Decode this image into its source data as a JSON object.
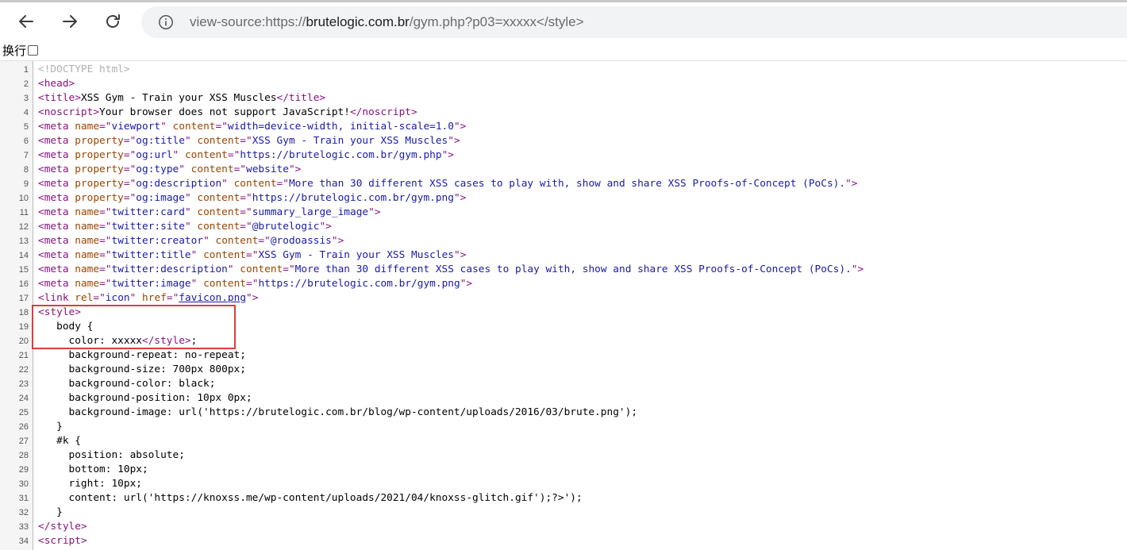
{
  "toolbar": {
    "url_scheme": "view-source:https://",
    "url_host": "brutelogic.com.br",
    "url_path": "/gym.php?p03=xxxxx</style>"
  },
  "wrap_toggle": {
    "label": "换行",
    "checked": false
  },
  "source_lines": [
    {
      "n": "1",
      "segs": [
        {
          "c": "cm",
          "t": "<!DOCTYPE html>"
        }
      ]
    },
    {
      "n": "2",
      "segs": [
        {
          "c": "tag",
          "t": "<head>"
        }
      ]
    },
    {
      "n": "3",
      "segs": [
        {
          "c": "tag",
          "t": "<title>"
        },
        {
          "c": "txt",
          "t": "XSS Gym - Train your XSS Muscles"
        },
        {
          "c": "tag",
          "t": "</title>"
        }
      ]
    },
    {
      "n": "4",
      "segs": [
        {
          "c": "tag",
          "t": "<noscript>"
        },
        {
          "c": "txt",
          "t": "Your browser does not support JavaScript!"
        },
        {
          "c": "tag",
          "t": "</noscript>"
        }
      ]
    },
    {
      "n": "5",
      "segs": [
        {
          "c": "tag",
          "t": "<meta "
        },
        {
          "c": "attr",
          "t": "name"
        },
        {
          "c": "tag",
          "t": "=\""
        },
        {
          "c": "val",
          "t": "viewport"
        },
        {
          "c": "tag",
          "t": "\" "
        },
        {
          "c": "attr",
          "t": "content"
        },
        {
          "c": "tag",
          "t": "=\""
        },
        {
          "c": "val",
          "t": "width=device-width, initial-scale=1.0"
        },
        {
          "c": "tag",
          "t": "\">"
        }
      ]
    },
    {
      "n": "6",
      "segs": [
        {
          "c": "tag",
          "t": "<meta "
        },
        {
          "c": "attr",
          "t": "property"
        },
        {
          "c": "tag",
          "t": "=\""
        },
        {
          "c": "val",
          "t": "og:title"
        },
        {
          "c": "tag",
          "t": "\" "
        },
        {
          "c": "attr",
          "t": "content"
        },
        {
          "c": "tag",
          "t": "=\""
        },
        {
          "c": "val",
          "t": "XSS Gym - Train your XSS Muscles"
        },
        {
          "c": "tag",
          "t": "\">"
        }
      ]
    },
    {
      "n": "7",
      "segs": [
        {
          "c": "tag",
          "t": "<meta "
        },
        {
          "c": "attr",
          "t": "property"
        },
        {
          "c": "tag",
          "t": "=\""
        },
        {
          "c": "val",
          "t": "og:url"
        },
        {
          "c": "tag",
          "t": "\" "
        },
        {
          "c": "attr",
          "t": "content"
        },
        {
          "c": "tag",
          "t": "=\""
        },
        {
          "c": "val",
          "t": "https://brutelogic.com.br/gym.php"
        },
        {
          "c": "tag",
          "t": "\">"
        }
      ]
    },
    {
      "n": "8",
      "segs": [
        {
          "c": "tag",
          "t": "<meta "
        },
        {
          "c": "attr",
          "t": "property"
        },
        {
          "c": "tag",
          "t": "=\""
        },
        {
          "c": "val",
          "t": "og:type"
        },
        {
          "c": "tag",
          "t": "\" "
        },
        {
          "c": "attr",
          "t": "content"
        },
        {
          "c": "tag",
          "t": "=\""
        },
        {
          "c": "val",
          "t": "website"
        },
        {
          "c": "tag",
          "t": "\">"
        }
      ]
    },
    {
      "n": "9",
      "segs": [
        {
          "c": "tag",
          "t": "<meta "
        },
        {
          "c": "attr",
          "t": "property"
        },
        {
          "c": "tag",
          "t": "=\""
        },
        {
          "c": "val",
          "t": "og:description"
        },
        {
          "c": "tag",
          "t": "\" "
        },
        {
          "c": "attr",
          "t": "content"
        },
        {
          "c": "tag",
          "t": "=\""
        },
        {
          "c": "val",
          "t": "More than 30 different XSS cases to play with, show and share XSS Proofs-of-Concept (PoCs)."
        },
        {
          "c": "tag",
          "t": "\">"
        }
      ]
    },
    {
      "n": "10",
      "segs": [
        {
          "c": "tag",
          "t": "<meta "
        },
        {
          "c": "attr",
          "t": "property"
        },
        {
          "c": "tag",
          "t": "=\""
        },
        {
          "c": "val",
          "t": "og:image"
        },
        {
          "c": "tag",
          "t": "\" "
        },
        {
          "c": "attr",
          "t": "content"
        },
        {
          "c": "tag",
          "t": "=\""
        },
        {
          "c": "val",
          "t": "https://brutelogic.com.br/gym.png"
        },
        {
          "c": "tag",
          "t": "\">"
        }
      ]
    },
    {
      "n": "11",
      "segs": [
        {
          "c": "tag",
          "t": "<meta "
        },
        {
          "c": "attr",
          "t": "name"
        },
        {
          "c": "tag",
          "t": "=\""
        },
        {
          "c": "val",
          "t": "twitter:card"
        },
        {
          "c": "tag",
          "t": "\" "
        },
        {
          "c": "attr",
          "t": "content"
        },
        {
          "c": "tag",
          "t": "=\""
        },
        {
          "c": "val",
          "t": "summary_large_image"
        },
        {
          "c": "tag",
          "t": "\">"
        }
      ]
    },
    {
      "n": "12",
      "segs": [
        {
          "c": "tag",
          "t": "<meta "
        },
        {
          "c": "attr",
          "t": "name"
        },
        {
          "c": "tag",
          "t": "=\""
        },
        {
          "c": "val",
          "t": "twitter:site"
        },
        {
          "c": "tag",
          "t": "\" "
        },
        {
          "c": "attr",
          "t": "content"
        },
        {
          "c": "tag",
          "t": "=\""
        },
        {
          "c": "val",
          "t": "@brutelogic"
        },
        {
          "c": "tag",
          "t": "\">"
        }
      ]
    },
    {
      "n": "13",
      "segs": [
        {
          "c": "tag",
          "t": "<meta "
        },
        {
          "c": "attr",
          "t": "name"
        },
        {
          "c": "tag",
          "t": "=\""
        },
        {
          "c": "val",
          "t": "twitter:creator"
        },
        {
          "c": "tag",
          "t": "\" "
        },
        {
          "c": "attr",
          "t": "content"
        },
        {
          "c": "tag",
          "t": "=\""
        },
        {
          "c": "val",
          "t": "@rodoassis"
        },
        {
          "c": "tag",
          "t": "\">"
        }
      ]
    },
    {
      "n": "14",
      "segs": [
        {
          "c": "tag",
          "t": "<meta "
        },
        {
          "c": "attr",
          "t": "name"
        },
        {
          "c": "tag",
          "t": "=\""
        },
        {
          "c": "val",
          "t": "twitter:title"
        },
        {
          "c": "tag",
          "t": "\" "
        },
        {
          "c": "attr",
          "t": "content"
        },
        {
          "c": "tag",
          "t": "=\""
        },
        {
          "c": "val",
          "t": "XSS Gym - Train your XSS Muscles"
        },
        {
          "c": "tag",
          "t": "\">"
        }
      ]
    },
    {
      "n": "15",
      "segs": [
        {
          "c": "tag",
          "t": "<meta "
        },
        {
          "c": "attr",
          "t": "name"
        },
        {
          "c": "tag",
          "t": "=\""
        },
        {
          "c": "val",
          "t": "twitter:description"
        },
        {
          "c": "tag",
          "t": "\" "
        },
        {
          "c": "attr",
          "t": "content"
        },
        {
          "c": "tag",
          "t": "=\""
        },
        {
          "c": "val",
          "t": "More than 30 different XSS cases to play with, show and share XSS Proofs-of-Concept (PoCs)."
        },
        {
          "c": "tag",
          "t": "\">"
        }
      ]
    },
    {
      "n": "16",
      "segs": [
        {
          "c": "tag",
          "t": "<meta "
        },
        {
          "c": "attr",
          "t": "name"
        },
        {
          "c": "tag",
          "t": "=\""
        },
        {
          "c": "val",
          "t": "twitter:image"
        },
        {
          "c": "tag",
          "t": "\" "
        },
        {
          "c": "attr",
          "t": "content"
        },
        {
          "c": "tag",
          "t": "=\""
        },
        {
          "c": "val",
          "t": "https://brutelogic.com.br/gym.png"
        },
        {
          "c": "tag",
          "t": "\">"
        }
      ]
    },
    {
      "n": "17",
      "segs": [
        {
          "c": "tag",
          "t": "<link "
        },
        {
          "c": "attr",
          "t": "rel"
        },
        {
          "c": "tag",
          "t": "=\""
        },
        {
          "c": "val",
          "t": "icon"
        },
        {
          "c": "tag",
          "t": "\" "
        },
        {
          "c": "attr",
          "t": "href"
        },
        {
          "c": "tag",
          "t": "=\""
        },
        {
          "c": "lnk",
          "t": "favicon.png"
        },
        {
          "c": "tag",
          "t": "\">"
        }
      ]
    },
    {
      "n": "18",
      "segs": [
        {
          "c": "tag",
          "t": "<style>"
        }
      ]
    },
    {
      "n": "19",
      "segs": [
        {
          "c": "txt",
          "t": "   body {"
        }
      ]
    },
    {
      "n": "20",
      "segs": [
        {
          "c": "txt",
          "t": "     color: xxxxx"
        },
        {
          "c": "tag",
          "t": "</style>"
        },
        {
          "c": "txt",
          "t": ";"
        }
      ]
    },
    {
      "n": "21",
      "segs": [
        {
          "c": "txt",
          "t": "     background-repeat: no-repeat;"
        }
      ]
    },
    {
      "n": "22",
      "segs": [
        {
          "c": "txt",
          "t": "     background-size: 700px 800px;"
        }
      ]
    },
    {
      "n": "23",
      "segs": [
        {
          "c": "txt",
          "t": "     background-color: black;"
        }
      ]
    },
    {
      "n": "24",
      "segs": [
        {
          "c": "txt",
          "t": "     background-position: 10px 0px;"
        }
      ]
    },
    {
      "n": "25",
      "segs": [
        {
          "c": "txt",
          "t": "     background-image: url('https://brutelogic.com.br/blog/wp-content/uploads/2016/03/brute.png');"
        }
      ]
    },
    {
      "n": "26",
      "segs": [
        {
          "c": "txt",
          "t": "   }"
        }
      ]
    },
    {
      "n": "27",
      "segs": [
        {
          "c": "txt",
          "t": "   #k {"
        }
      ]
    },
    {
      "n": "28",
      "segs": [
        {
          "c": "txt",
          "t": "     position: absolute;"
        }
      ]
    },
    {
      "n": "29",
      "segs": [
        {
          "c": "txt",
          "t": "     bottom: 10px;"
        }
      ]
    },
    {
      "n": "30",
      "segs": [
        {
          "c": "txt",
          "t": "     right: 10px;"
        }
      ]
    },
    {
      "n": "31",
      "segs": [
        {
          "c": "txt",
          "t": "     content: url('https://knoxss.me/wp-content/uploads/2021/04/knoxss-glitch.gif');?>');"
        }
      ]
    },
    {
      "n": "32",
      "segs": [
        {
          "c": "txt",
          "t": "   }"
        }
      ]
    },
    {
      "n": "33",
      "segs": [
        {
          "c": "tag",
          "t": "</style>"
        }
      ]
    },
    {
      "n": "34",
      "segs": [
        {
          "c": "tag",
          "t": "<script>"
        }
      ]
    }
  ]
}
